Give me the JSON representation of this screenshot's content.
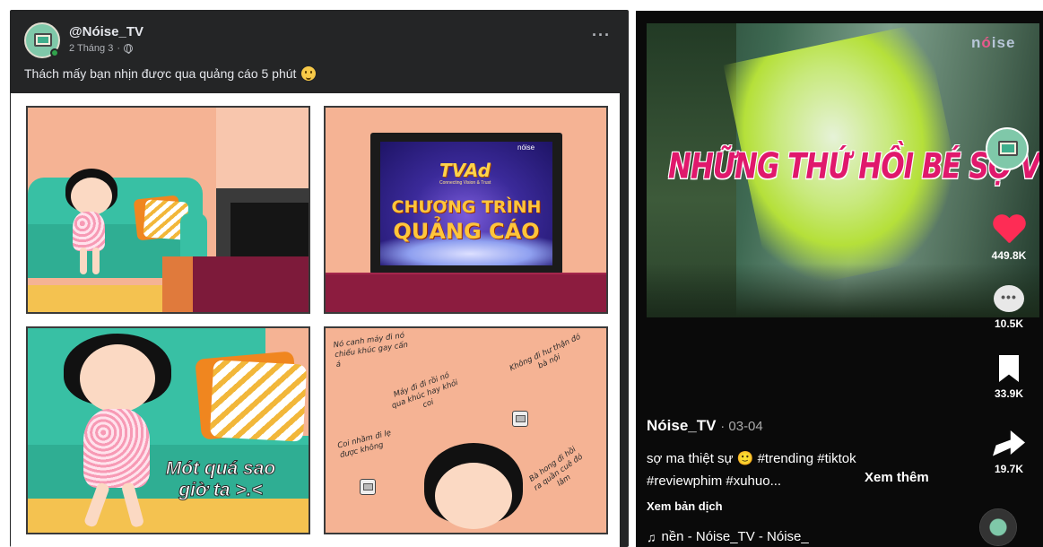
{
  "facebook_post": {
    "page_name": "@Nóise_TV",
    "date": "2 Tháng 3",
    "separator": "·",
    "more_label": "···",
    "caption": "Thách mấy bạn nhịn được qua quảng cáo 5 phút",
    "comic": {
      "panel2": {
        "tvad_logo": "TVAd",
        "tvad_sub": "Connecting Vision & Trust",
        "line1": "CHƯƠNG TRÌNH",
        "line2": "QUẢNG CÁO",
        "brand": "nóise"
      },
      "panel3": {
        "caption": "Mót quá sao giờ ta >.<"
      },
      "panel4": {
        "bubble1": "Nó canh máy đi nó chiếu khúc gay cấn á",
        "bubble2": "Máy đi đi rồi nó qua khúc hay khỏi coi",
        "bubble3": "Không đi hư thận đó bà nội",
        "bubble4": "Coi nhầm đi lẹ được không",
        "bubble5": "Bà hong đi hồi ra quần cuê đó lâm"
      }
    }
  },
  "tiktok": {
    "watermark_prefix": "n",
    "watermark_accent": "ó",
    "watermark_suffix": "ise",
    "overlay_text": "NHỮNG THỨ HỒI BÉ SỢ VL SỰ",
    "likes": "449.8K",
    "comments": "10.5K",
    "saves": "33.9K",
    "shares": "19.7K",
    "username": "Nóise_TV",
    "date": "· 03-04",
    "description_line1": "sợ ma thiệt sự 🙂 #trending #tiktok",
    "description_line2": "#reviewphim #xuhuo...",
    "see_more": "Xem thêm",
    "translate": "Xem bản dịch",
    "music_icon": "♫",
    "music": "nền - Nóise_TV - Nóise_"
  },
  "colors": {
    "fb_bg": "#242526",
    "tt_bg": "#0a0a0a",
    "like_red": "#fe2c55",
    "overlay_pink": "#e0186c"
  }
}
